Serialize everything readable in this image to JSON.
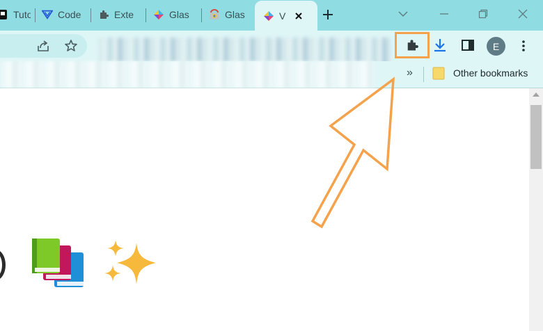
{
  "tabs": [
    {
      "label": "Tuto",
      "icon": "bookmark-black-icon"
    },
    {
      "label": "Code",
      "icon": "code-logo-icon"
    },
    {
      "label": "Exte",
      "icon": "puzzle-icon"
    },
    {
      "label": "Glas",
      "icon": "glasp-logo-icon"
    },
    {
      "label": "Glas",
      "icon": "chrome-store-icon"
    },
    {
      "label": "V",
      "icon": "glasp-logo-icon",
      "active": true
    }
  ],
  "window_controls": [
    "chevron-down-icon",
    "minimize-icon",
    "restore-icon",
    "close-icon"
  ],
  "toolbar": {
    "profile_initial": "E",
    "extensions_highlight_color": "#f4a24c"
  },
  "bookmarks": {
    "overflow": "»",
    "other_label": "Other bookmarks"
  },
  "annotation": {
    "arrow_color": "#f4a24c"
  },
  "content": {
    "emojis": [
      "books-icon",
      "sparkles-icon"
    ]
  }
}
